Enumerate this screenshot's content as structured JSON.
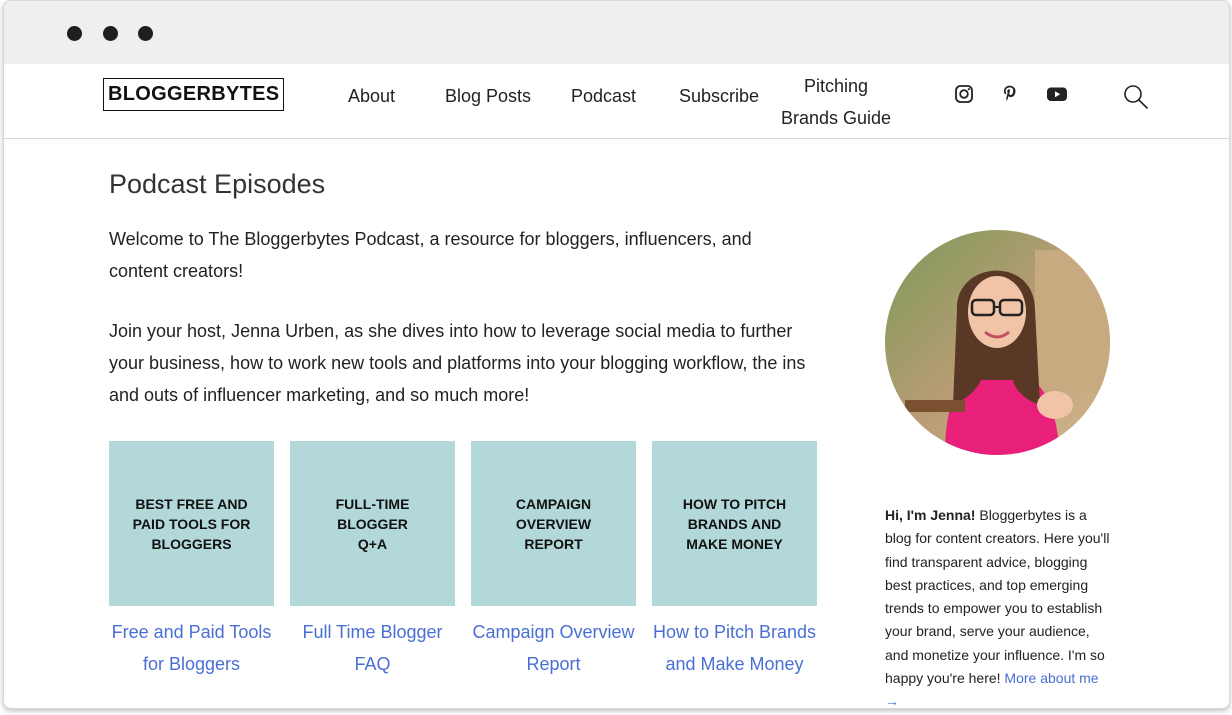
{
  "site": {
    "logo": "BLOGGERBYTES",
    "nav": [
      "About",
      "Blog Posts",
      "Podcast",
      "Subscribe",
      "Pitching Brands Guide"
    ],
    "social": [
      "instagram-icon",
      "pinterest-icon",
      "youtube-icon"
    ]
  },
  "page": {
    "title": "Podcast Episodes",
    "intro": "Welcome to The Bloggerbytes Podcast, a resource for bloggers, influencers, and content creators!",
    "host": "Join your host, Jenna Urben, as she dives into how to leverage social media to further your business, how to work new tools and platforms into your blogging workflow, the ins and outs of influencer marketing, and so much more!"
  },
  "episodes": [
    {
      "thumb": "BEST FREE AND PAID TOOLS FOR BLOGGERS",
      "link": "Free and Paid Tools for Bloggers"
    },
    {
      "thumb": "FULL-TIME BLOGGER Q+A",
      "link": "Full Time Blogger FAQ"
    },
    {
      "thumb": "CAMPAIGN OVERVIEW REPORT",
      "link": "Campaign Overview Report"
    },
    {
      "thumb": "HOW TO PITCH BRANDS AND MAKE MONEY",
      "link": "How to Pitch Brands and Make Money"
    }
  ],
  "sidebar": {
    "bio_name": "Hi, I'm Jenna!",
    "bio_text": " Bloggerbytes is a blog for content creators. Here you'll find transparent advice, blogging best practices, and top emerging trends to empower you to establish your brand, serve your audience, and monetize your influence. I'm so happy you're here! ",
    "more_link": "More about me →"
  },
  "colors": {
    "accent_link": "#4a6fd4",
    "thumb_bg": "#b3d8da"
  }
}
